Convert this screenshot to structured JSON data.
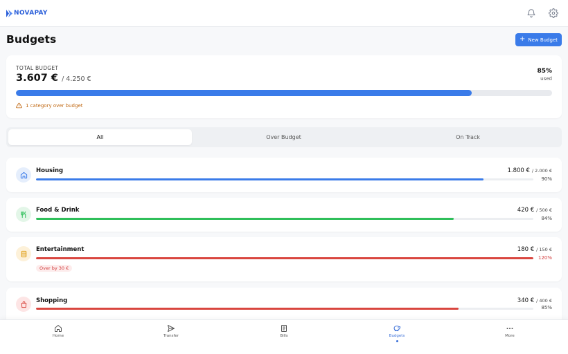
{
  "app": {
    "brand": "NOVAPAY"
  },
  "page": {
    "title": "Budgets",
    "new_button": "New Budget"
  },
  "summary": {
    "label": "TOTAL BUDGET",
    "spent": "3.607 €",
    "total": "/ 4.250 €",
    "percent_text": "85%",
    "used_label": "used",
    "progress": 0.85,
    "warning": "1 category over budget"
  },
  "tabs": [
    "All",
    "Over Budget",
    "On Track"
  ],
  "active_tab": "All",
  "categories": [
    {
      "name": "Housing",
      "spent": "1.800 €",
      "limit": "/ 2.000 €",
      "percent": "90%",
      "progress": 0.9,
      "color": "#3a7be9",
      "icon": "home-icon",
      "icon_bg": "#e5eefc",
      "over": false
    },
    {
      "name": "Food & Drink",
      "spent": "420 €",
      "limit": "/ 500 €",
      "percent": "84%",
      "progress": 0.84,
      "color": "#2fbf5a",
      "icon": "utensils-icon",
      "icon_bg": "#e3f6e8",
      "over": false
    },
    {
      "name": "Entertainment",
      "spent": "180 €",
      "limit": "/ 150 €",
      "percent": "120%",
      "progress": 1.0,
      "color": "#d9463f",
      "icon": "film-icon",
      "icon_bg": "#fdf1d9",
      "over": true,
      "over_text": "Over by 30 €"
    },
    {
      "name": "Shopping",
      "spent": "340 €",
      "limit": "/ 400 €",
      "percent": "85%",
      "progress": 0.85,
      "color": "#d9463f",
      "icon": "shopping-bag-icon",
      "icon_bg": "#fde5e5",
      "over": false
    }
  ],
  "nav": {
    "items": [
      "Home",
      "Transfer",
      "Bills",
      "Budgets",
      "More"
    ],
    "active": "Budgets"
  },
  "colors": {
    "accent": "#3a7be9",
    "warning": "#c06812",
    "danger": "#d23c3c"
  }
}
